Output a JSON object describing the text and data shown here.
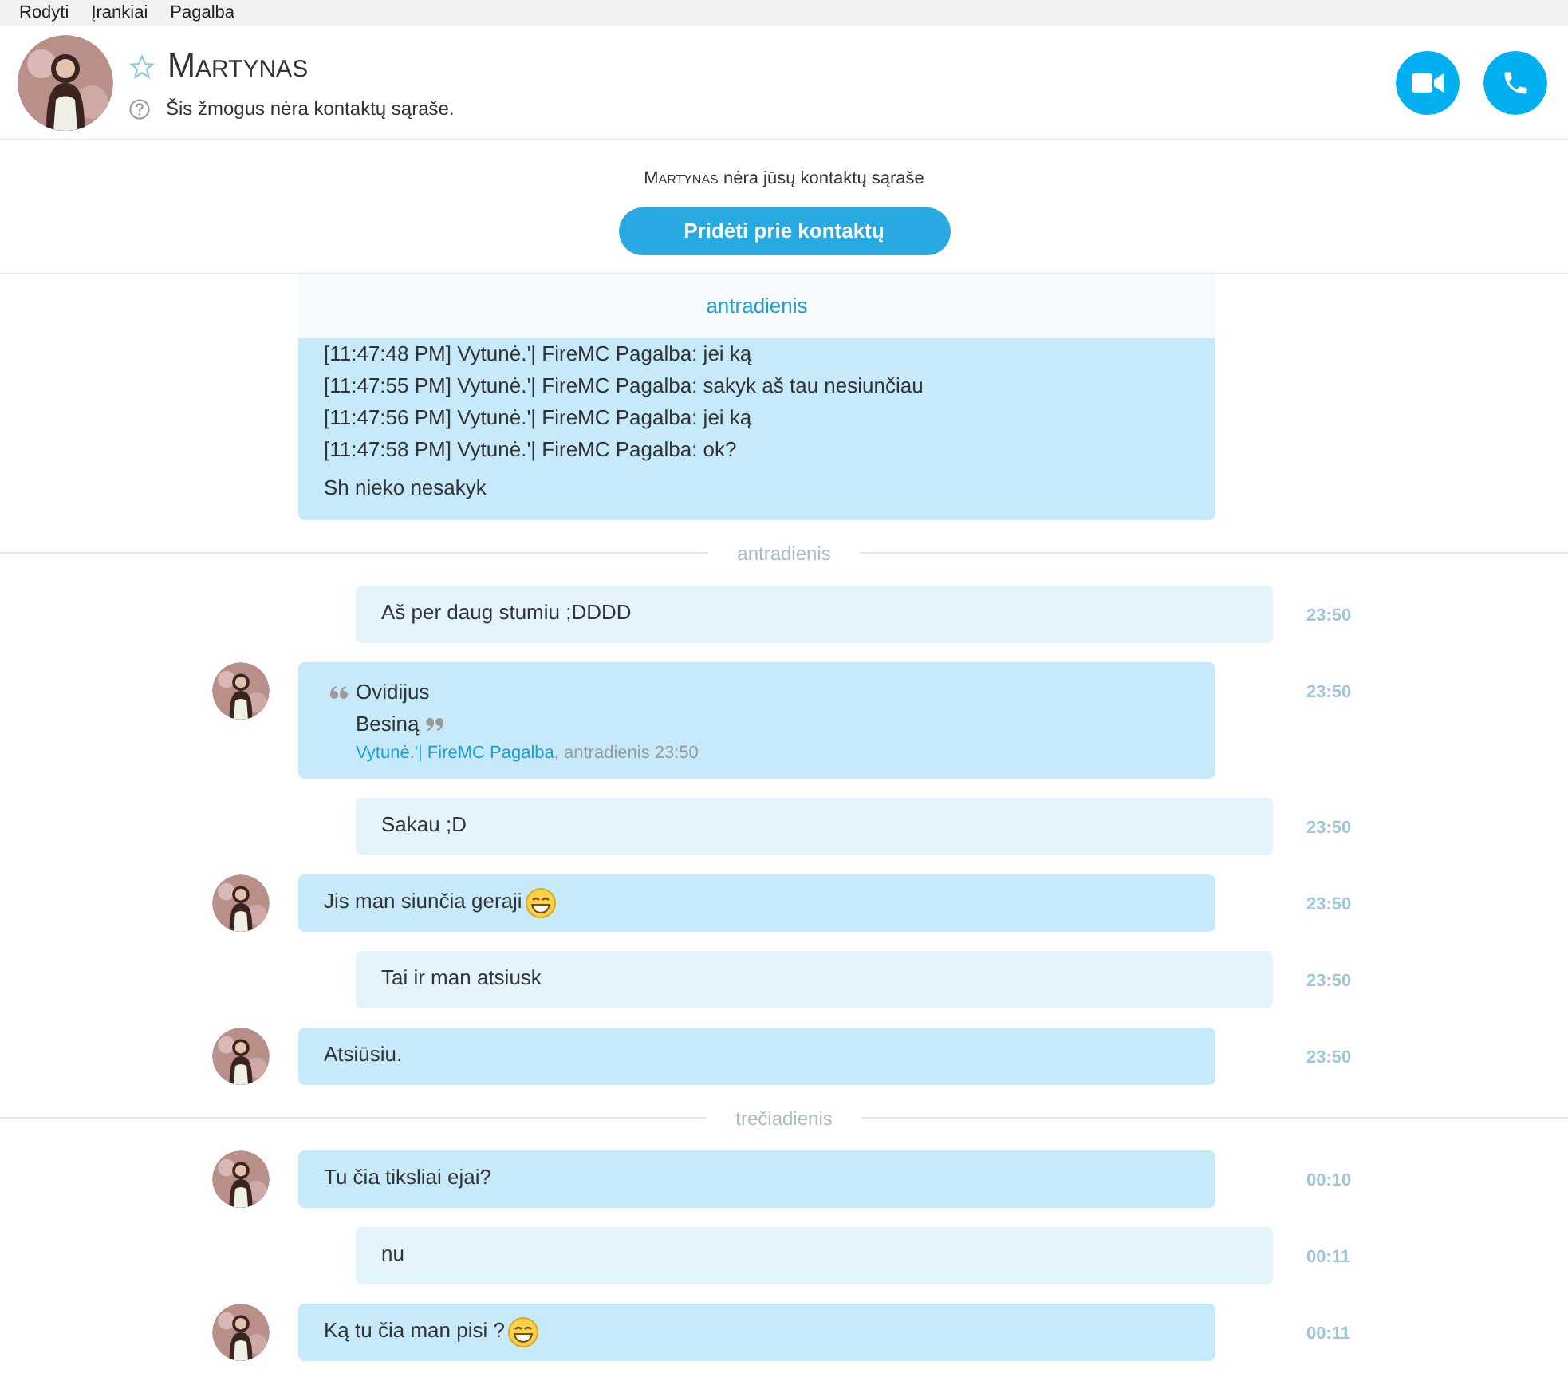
{
  "menu": [
    "Rodyti",
    "Įrankiai",
    "Pagalba"
  ],
  "contact": {
    "name": "Martynas",
    "status": "Šis žmogus nėra kontaktų sąraše.",
    "favorite": false
  },
  "notice": {
    "name": "Martynas",
    "text": "nėra jūsų kontaktų sąraše",
    "button": "Pridėti prie kontaktų"
  },
  "sticky_date": "antradienis",
  "log": {
    "lines": [
      "[11:47:48 PM] Vytunė.'| FireMC Pagalba: jei ką",
      "[11:47:55 PM] Vytunė.'| FireMC Pagalba: sakyk aš tau nesiunčiau",
      "[11:47:56 PM] Vytunė.'| FireMC Pagalba: jei ką",
      "[11:47:58 PM] Vytunė.'| FireMC Pagalba: ok?"
    ],
    "text": "Sh nieko nesakyk"
  },
  "feed": [
    {
      "kind": "date",
      "label": "antradienis"
    },
    {
      "kind": "message",
      "incoming": false,
      "text": "Aš per daug stumiu ;DDDD",
      "time": "23:50"
    },
    {
      "kind": "quote",
      "incoming": true,
      "quote_lines": [
        "Ovidijus",
        "Besiną"
      ],
      "author": "Vytunė.'| FireMC Pagalba",
      "meta": ", antradienis 23:50",
      "time": "23:50"
    },
    {
      "kind": "message",
      "incoming": false,
      "text": "Sakau ;D",
      "time": "23:50"
    },
    {
      "kind": "message",
      "incoming": true,
      "text": "Jis man siunčia geraji",
      "emoji": true,
      "time": "23:50"
    },
    {
      "kind": "message",
      "incoming": false,
      "text": "Tai ir man atsiusk",
      "time": "23:50"
    },
    {
      "kind": "message",
      "incoming": true,
      "text": "Atsiūsiu.",
      "time": "23:50"
    },
    {
      "kind": "date",
      "label": "trečiadienis"
    },
    {
      "kind": "message",
      "incoming": true,
      "text": "Tu čia tiksliai ejai?",
      "time": "00:10"
    },
    {
      "kind": "message",
      "incoming": false,
      "text": "nu",
      "time": "00:11"
    },
    {
      "kind": "message",
      "incoming": true,
      "text": "Ką tu čia man pisi ?",
      "emoji": true,
      "time": "00:11"
    }
  ]
}
